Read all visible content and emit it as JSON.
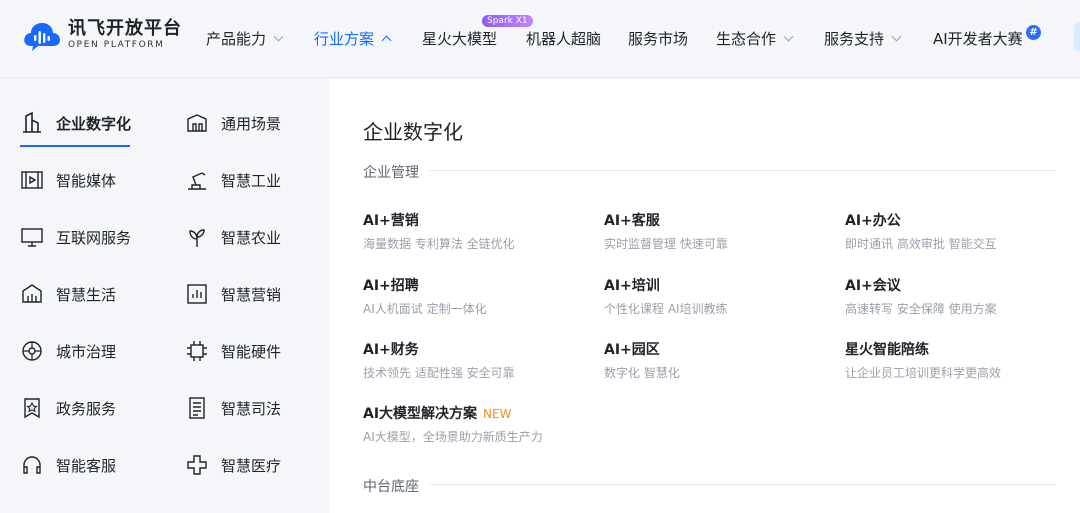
{
  "brand": {
    "name_cn": "讯飞开放平台",
    "name_en": "OPEN PLATFORM",
    "accent": "#1769ff"
  },
  "nav": {
    "items": [
      {
        "label": "产品能力",
        "has_dropdown": true
      },
      {
        "label": "行业方案",
        "has_dropdown": true,
        "active": true
      },
      {
        "label": "星火大模型",
        "badge": "Spark X1"
      },
      {
        "label": "机器人超脑"
      },
      {
        "label": "服务市场"
      },
      {
        "label": "生态合作",
        "has_dropdown": true
      },
      {
        "label": "服务支持",
        "has_dropdown": true
      },
      {
        "label": "AI开发者大赛",
        "badge": "#"
      }
    ]
  },
  "categories": [
    {
      "label": "企业数字化",
      "icon": "building-icon",
      "active": true
    },
    {
      "label": "通用场景",
      "icon": "store-icon"
    },
    {
      "label": "智能媒体",
      "icon": "film-icon"
    },
    {
      "label": "智慧工业",
      "icon": "robot-arm-icon"
    },
    {
      "label": "互联网服务",
      "icon": "monitor-icon"
    },
    {
      "label": "智慧农业",
      "icon": "plant-icon"
    },
    {
      "label": "智慧生活",
      "icon": "house-icon"
    },
    {
      "label": "智慧营销",
      "icon": "chart-icon"
    },
    {
      "label": "城市治理",
      "icon": "city-icon"
    },
    {
      "label": "智能硬件",
      "icon": "chip-icon"
    },
    {
      "label": "政务服务",
      "icon": "badge-star-icon"
    },
    {
      "label": "智慧司法",
      "icon": "document-icon"
    },
    {
      "label": "智能客服",
      "icon": "headset-icon"
    },
    {
      "label": "智慧医疗",
      "icon": "medical-cross-icon"
    }
  ],
  "panel": {
    "title": "企业数字化",
    "section1": "企业管理",
    "section2": "中台底座",
    "solutions": [
      {
        "title": "AI+营销",
        "desc": "海量数据 专利算法 全链优化"
      },
      {
        "title": "AI+客服",
        "desc": "实时监督管理 快速可靠"
      },
      {
        "title": "AI+办公",
        "desc": "即时通讯 高效审批 智能交互"
      },
      {
        "title": "AI+招聘",
        "desc": "AI人机面试 定制一体化"
      },
      {
        "title": "AI+培训",
        "desc": "个性化课程 AI培训教练"
      },
      {
        "title": "AI+会议",
        "desc": "高速转写 安全保障 使用方案"
      },
      {
        "title": "AI+财务",
        "desc": "技术领先 适配性强 安全可靠"
      },
      {
        "title": "AI+园区",
        "desc": "数字化 智慧化"
      },
      {
        "title": "星火智能陪练",
        "desc": "让企业员工培训更科学更高效"
      },
      {
        "title": "AI大模型解决方案",
        "tag": "NEW",
        "desc": "AI大模型，全场景助力新质生产力"
      }
    ]
  }
}
